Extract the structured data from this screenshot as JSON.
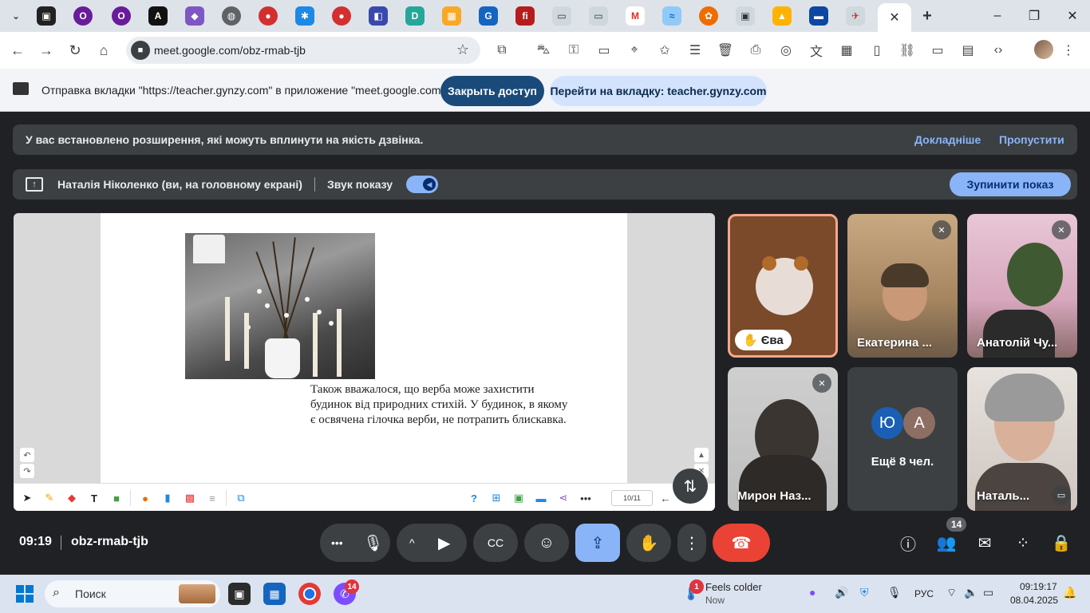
{
  "browser": {
    "tabs": [
      "",
      "",
      "",
      "",
      "",
      "",
      "",
      "",
      "",
      "",
      "",
      "",
      "",
      "",
      "",
      "",
      "",
      "",
      "",
      "",
      "",
      "",
      ""
    ],
    "active_tab_close": "✕",
    "address_url": "meet.google.com/obz-rmab-tjb"
  },
  "infobar": {
    "message": "Отправка вкладки \"https://teacher.gynzy.com\" в приложение \"meet.google.com\"...",
    "stop_access_label": "Закрыть доступ",
    "goto_tab_label": "Перейти на вкладку: teacher.gynzy.com"
  },
  "meet": {
    "warning_text": "У вас встановлено розширення, які можуть вплинути на якість дзвінка.",
    "warning_details": "Докладніше",
    "warning_skip": "Пропустити",
    "presenter_text": "Наталія Ніколенко (ви, на головному екрані)",
    "sound_label": "Звук показу",
    "sound_on": true,
    "stop_presenting_label": "Зупинити показ",
    "slide": {
      "text": "Також вважалося, що верба може захистити будинок від природних стихій. У будинок, в якому є освячена гілочка верби,  не потрапить блискавка.",
      "page_indicator": "10/11"
    },
    "participants": [
      {
        "name": "Єва",
        "hand_raised": true,
        "muted": false,
        "active": true
      },
      {
        "name": "Екатерина ...",
        "muted": true
      },
      {
        "name": "Анатолій Чу...",
        "muted": true
      },
      {
        "name": "Мирон Наз...",
        "muted": true
      },
      {
        "name": "Ещё 8 чел.",
        "avatars": [
          "Ю",
          "А"
        ],
        "avatar_colors": [
          "#1a5fb4",
          "#8d6e63"
        ]
      },
      {
        "name": "Наталь...",
        "muted": false
      }
    ],
    "time": "09:19",
    "meeting_code": "obz-rmab-tjb",
    "participant_count": "14"
  },
  "taskbar": {
    "search_placeholder": "Поиск",
    "viber_badge": "14",
    "weather_badge": "1",
    "weather_title": "Feels colder",
    "weather_sub": "Now",
    "language": "РУС",
    "time": "09:19:17",
    "date": "08.04.2025"
  },
  "colors": {
    "meet_bg": "#202124",
    "accent_blue": "#8ab4f8",
    "end_call_red": "#ea4335",
    "active_tile_border": "#f6a78b"
  }
}
